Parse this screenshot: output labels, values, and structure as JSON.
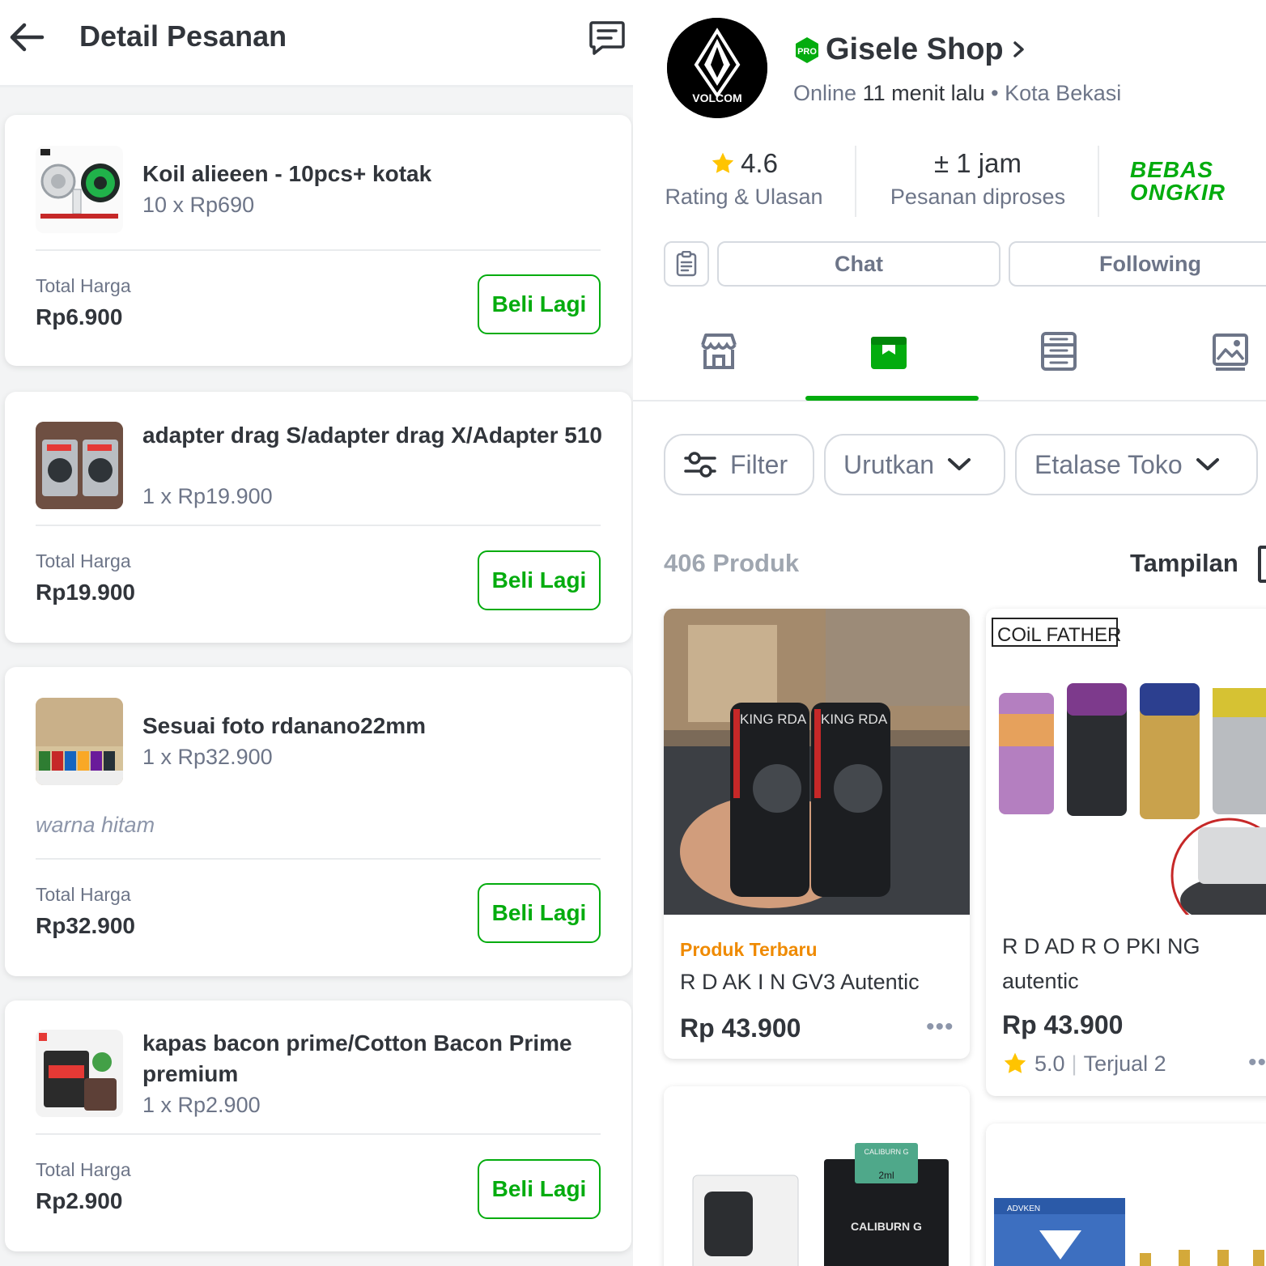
{
  "order": {
    "title": "Detail Pesanan",
    "total_label": "Total Harga",
    "rebuy_label": "Beli Lagi",
    "items": [
      {
        "name": "Koil alieeen - 10pcs+ kotak",
        "qty_price": "10 x Rp690",
        "total": "Rp6.900"
      },
      {
        "name": "adapter drag S/adapter drag X/Adapter 510",
        "qty_price": "1 x Rp19.900",
        "total": "Rp19.900"
      },
      {
        "name": "Sesuai foto rdanano22mm",
        "qty_price": "1 x Rp32.900",
        "note": "warna hitam",
        "total": "Rp32.900"
      },
      {
        "name": "kapas bacon prime/Cotton Bacon Prime premium",
        "qty_price": "1 x Rp2.900",
        "total": "Rp2.900"
      }
    ]
  },
  "shop": {
    "logo_text": "VOLCOM",
    "badge": "PRO",
    "name": "Gisele Shop",
    "status_prefix": "Online",
    "status_time": "11 menit lalu",
    "status_sep": "•",
    "location": "Kota Bekasi",
    "rating_value": "4.6",
    "rating_label": "Rating & Ulasan",
    "process_value": "± 1 jam",
    "process_label": "Pesanan diproses",
    "free_shipping_line1": "BEBAS",
    "free_shipping_line2": "ONGKIR",
    "chat_label": "Chat",
    "following_label": "Following",
    "tabs": [
      {
        "icon": "store-icon",
        "active": false
      },
      {
        "icon": "product-icon",
        "active": true
      },
      {
        "icon": "feed-icon",
        "active": false
      },
      {
        "icon": "gallery-icon",
        "active": false
      }
    ],
    "filter_label": "Filter",
    "sort_label": "Urutkan",
    "showcase_label": "Etalase Toko",
    "product_count": "406 Produk",
    "view_label": "Tampilan",
    "products": [
      {
        "tag": "Produk Terbaru",
        "name": "R D AK I N GV3 Autentic",
        "price": "Rp 43.900",
        "image_label_1": "KING RDA",
        "image_label_2": "KING RDA"
      },
      {
        "brand": "COiL FATHER",
        "name_line1": "R D AD R O PKI NG",
        "name_line2": "autentic",
        "price": "Rp 43.900",
        "rating": "5.0",
        "sold": "Terjual 2"
      },
      {
        "box_label_top": "CALIBURN G",
        "box_label_sub": "2ml",
        "box_label_brand": "CALIBURN G"
      },
      {
        "box_label_brand": "ADVKEN"
      }
    ],
    "accent_color": "#03ac0e",
    "tag_color": "#ef8a00"
  }
}
